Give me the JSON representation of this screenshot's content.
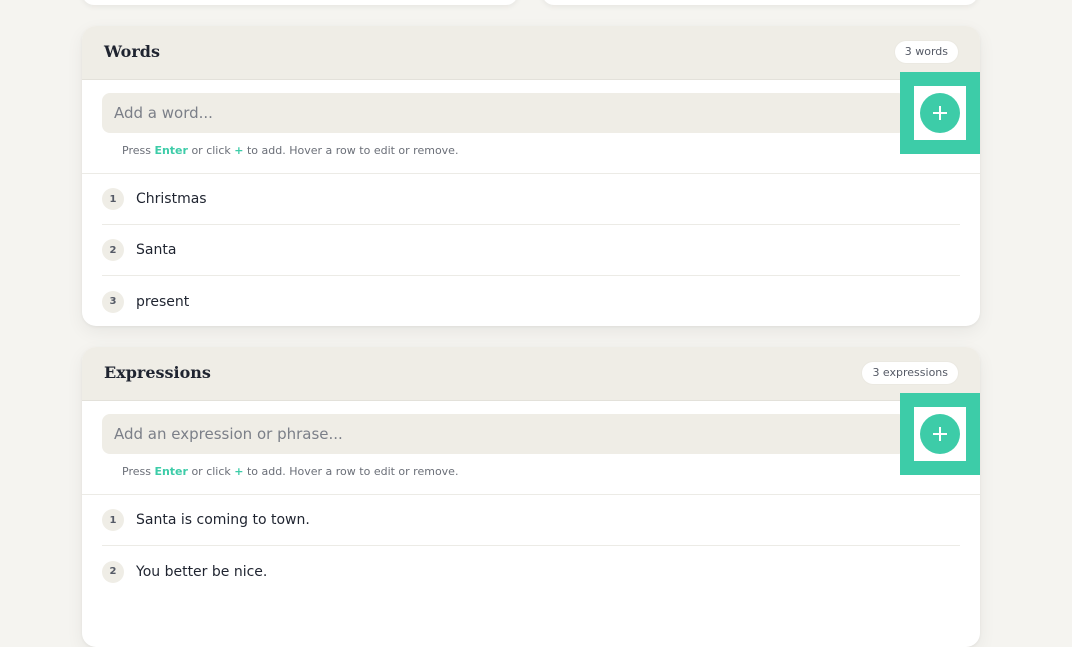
{
  "words": {
    "title": "Words",
    "count": "3 words",
    "placeholder": "Add a word...",
    "hint": {
      "press": "Press ",
      "enter": "Enter",
      "or_click": " or click ",
      "plus": "+",
      "rest": " to add. Hover a row to edit or remove."
    },
    "items": [
      {
        "num": "1",
        "text": "Christmas"
      },
      {
        "num": "2",
        "text": "Santa"
      },
      {
        "num": "3",
        "text": "present"
      }
    ]
  },
  "expressions": {
    "title": "Expressions",
    "count": "3 expressions",
    "placeholder": "Add an expression or phrase...",
    "hint": {
      "press": "Press ",
      "enter": "Enter",
      "or_click": " or click ",
      "plus": "+",
      "rest": " to add. Hover a row to edit or remove."
    },
    "items": [
      {
        "num": "1",
        "text": "Santa is coming to town."
      },
      {
        "num": "2",
        "text": "You better be nice."
      }
    ]
  },
  "colors": {
    "accent": "#3dcca8",
    "header_bg": "#efede6",
    "page_bg": "#f5f4f0"
  },
  "icons": {
    "add": "plus-icon"
  }
}
